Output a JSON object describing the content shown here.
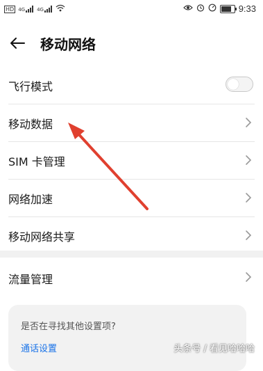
{
  "status_bar": {
    "left_icons": [
      "hd-icon",
      "signal-4g-icon",
      "signal-4g-icon-2",
      "wifi-icon"
    ],
    "hd_text": "HD",
    "signal1_text": "4G",
    "signal2_text": "4G",
    "time": "9:33"
  },
  "header": {
    "title": "移动网络"
  },
  "settings": {
    "items": [
      {
        "label": "飞行模式",
        "type": "toggle",
        "on": false
      },
      {
        "label": "移动数据",
        "type": "nav"
      },
      {
        "label": "SIM 卡管理",
        "type": "nav"
      },
      {
        "label": "网络加速",
        "type": "nav"
      },
      {
        "label": "移动网络共享",
        "type": "nav"
      }
    ],
    "items2": [
      {
        "label": "流量管理",
        "type": "nav"
      }
    ]
  },
  "card": {
    "question": "是否在寻找其他设置项?",
    "link": "通话设置"
  },
  "watermark": "头条号 / 看见哈哈哈",
  "colors": {
    "accent_link": "#1a73e8",
    "annotation_arrow": "#e0402f"
  }
}
